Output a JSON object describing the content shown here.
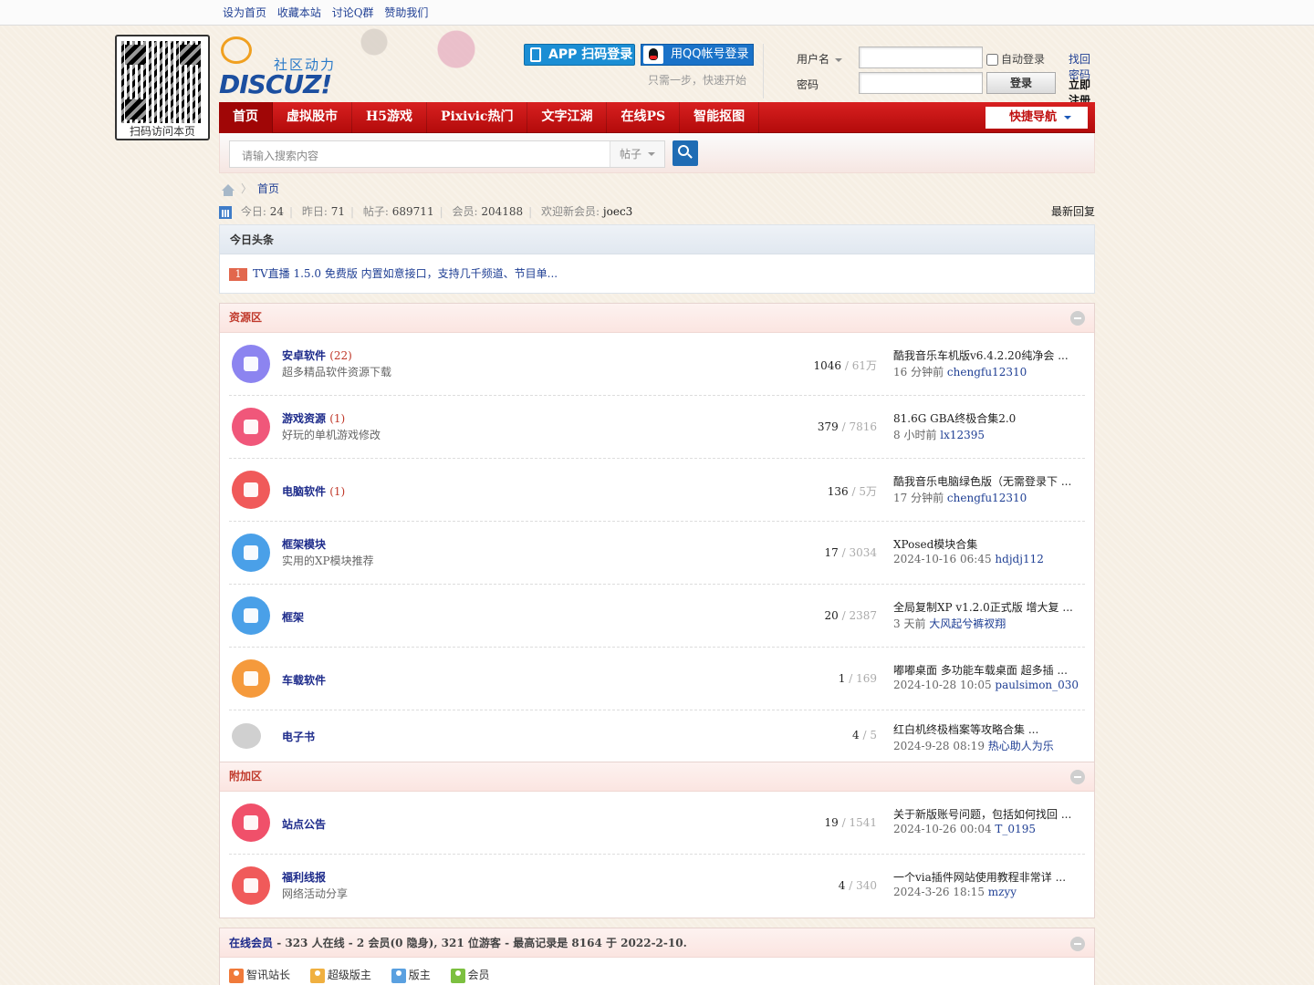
{
  "topbar": {
    "links": [
      "设为首页",
      "收藏本站",
      "讨论Q群",
      "赞助我们"
    ]
  },
  "qr": {
    "caption": "扫码访问本页"
  },
  "logo": {
    "sub": "社区动力",
    "main": "DISCUZ!"
  },
  "social": {
    "app_login": "APP 扫码登录",
    "qq_login": "用QQ帐号登录",
    "hint": "只需一步，快速开始"
  },
  "login": {
    "username_label": "用户名",
    "password_label": "密码",
    "auto_login": "自动登录",
    "find_password": "找回密码",
    "login_button": "登录",
    "register": "立即注册"
  },
  "nav": {
    "items": [
      "首页",
      "虚拟股市",
      "H5游戏",
      "Pixivic热门",
      "文字江湖",
      "在线PS",
      "智能抠图"
    ],
    "quick": "快捷导航"
  },
  "search": {
    "placeholder": "请输入搜索内容",
    "type": "帖子"
  },
  "breadcrumb": {
    "home": "首页"
  },
  "stats": {
    "today_label": "今日:",
    "today": "24",
    "yesterday_label": "昨日:",
    "yesterday": "71",
    "posts_label": "帖子:",
    "posts": "689711",
    "members_label": "会员:",
    "members": "204188",
    "welcome_label": "欢迎新会员:",
    "new_member": "joec3",
    "latest_reply": "最新回复"
  },
  "headline": {
    "title": "今日头条",
    "num": "1",
    "text": "TV直播 1.5.0 免费版 内置如意接口，支持几千频道、节目单..."
  },
  "categories": [
    {
      "title": "资源区",
      "forums": [
        {
          "name": "安卓软件",
          "count": "(22)",
          "desc": "超多精品软件资源下载",
          "topics": "1046",
          "posts": "61万",
          "last_title": "酷我音乐车机版v6.4.2.20纯净会 ...",
          "last_time": "16 分钟前",
          "last_user": "chengfu12310",
          "icon_color": "#8c84f0"
        },
        {
          "name": "游戏资源",
          "count": "(1)",
          "desc": "好玩的单机游戏修改",
          "topics": "379",
          "posts": "7816",
          "last_title": "81.6G GBA终极合集2.0",
          "last_time": "8 小时前",
          "last_user": "lx12395",
          "icon_color": "#f0577a"
        },
        {
          "name": "电脑软件",
          "count": "(1)",
          "desc": "",
          "topics": "136",
          "posts": "5万",
          "last_title": "酷我音乐电脑绿色版（无需登录下 ...",
          "last_time": "17 分钟前",
          "last_user": "chengfu12310",
          "icon_color": "#f05a5a"
        },
        {
          "name": "框架模块",
          "count": "",
          "desc": "实用的XP模块推荐",
          "topics": "17",
          "posts": "3034",
          "last_title": "XPosed模块合集",
          "last_time": "2024-10-16 06:45",
          "last_user": "hdjdj112",
          "icon_color": "#4aa0e8"
        },
        {
          "name": "框架",
          "count": "",
          "desc": "",
          "topics": "20",
          "posts": "2387",
          "last_title": "全局复制XP v1.2.0正式版 增大复 ...",
          "last_time": "3 天前",
          "last_user": "大风起兮裤衩翔",
          "icon_color": "#4aa0e8"
        },
        {
          "name": "车载软件",
          "count": "",
          "desc": "",
          "topics": "1",
          "posts": "169",
          "last_title": "嘟嘟桌面 多功能车载桌面 超多插 ...",
          "last_time": "2024-10-28 10:05",
          "last_user": "paulsimon_030",
          "icon_color": "#f59a3c"
        },
        {
          "name": "电子书",
          "count": "",
          "desc": "",
          "topics": "4",
          "posts": "5",
          "last_title": "红白机终极档案等攻略合集 ...",
          "last_time": "2024-9-28 08:19",
          "last_user": "热心助人为乐",
          "icon_color": "#d0d0d0"
        }
      ]
    },
    {
      "title": "附加区",
      "forums": [
        {
          "name": "站点公告",
          "count": "",
          "desc": "",
          "topics": "19",
          "posts": "1541",
          "last_title": "关于新版账号问题，包括如何找回 ...",
          "last_time": "2024-10-26 00:04",
          "last_user": "T_0195",
          "icon_color": "#f0506a"
        },
        {
          "name": "福利线报",
          "count": "",
          "desc": "网络活动分享",
          "topics": "4",
          "posts": "340",
          "last_title": "一个via插件网站使用教程非常详 ...",
          "last_time": "2024-3-26 18:15",
          "last_user": "mzyy",
          "icon_color": "#f05a5a"
        }
      ]
    }
  ],
  "online": {
    "title": "在线会员",
    "summary": " - 323 人在线 - 2 会员(0 隐身), 321 位游客 - 最高记录是 8164 于 2022-2-10.",
    "legend": [
      {
        "label": "智讯站长",
        "color": "#f07a3a"
      },
      {
        "label": "超级版主",
        "color": "#f0b040"
      },
      {
        "label": "版主",
        "color": "#5aa0e0"
      },
      {
        "label": "会员",
        "color": "#7cc040"
      }
    ]
  }
}
